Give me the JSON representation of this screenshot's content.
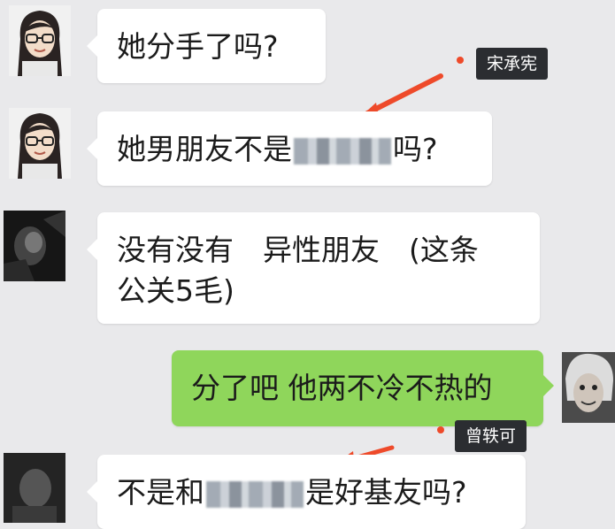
{
  "messages": [
    {
      "from": "left",
      "avatar": "girl-avatar",
      "text": "她分手了吗?"
    },
    {
      "from": "left",
      "avatar": "girl-avatar",
      "text_before": "她男朋友不是",
      "text_after": "吗?",
      "redacted": true
    },
    {
      "from": "left",
      "avatar": "dark-avatar",
      "line1": "没有没有　异性朋友　(这条",
      "line2": "公关5毛)"
    },
    {
      "from": "right",
      "avatar": "face-avatar",
      "text": "分了吧 他两不冷不热的"
    },
    {
      "from": "left",
      "avatar": "dark-avatar",
      "text_before": "不是和",
      "text_after": "是好基友吗?",
      "redacted": true
    }
  ],
  "annotations": {
    "tag1": "宋承宪",
    "tag2": "曾轶可",
    "accent_color": "#ee4a2a"
  },
  "colors": {
    "background": "#e9e9eb",
    "incoming_bubble": "#ffffff",
    "outgoing_bubble": "#8fd65b"
  }
}
